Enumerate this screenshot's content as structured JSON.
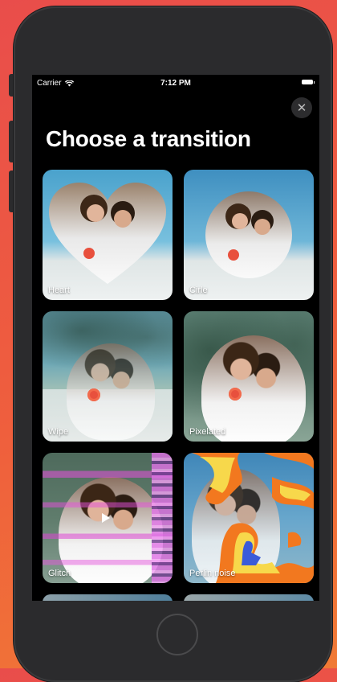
{
  "status_bar": {
    "carrier": "Carrier",
    "time": "7:12 PM"
  },
  "header": {
    "title": "Choose a transition",
    "close_icon": "close-icon"
  },
  "transitions": [
    {
      "label": "Heart"
    },
    {
      "label": "Cirle"
    },
    {
      "label": "Wipe"
    },
    {
      "label": "Pixelated"
    },
    {
      "label": "Glitch"
    },
    {
      "label": "Perlin noise"
    }
  ],
  "colors": {
    "background": "#000000",
    "card_text": "#ffffff",
    "bezel": "#2b2b2d"
  }
}
